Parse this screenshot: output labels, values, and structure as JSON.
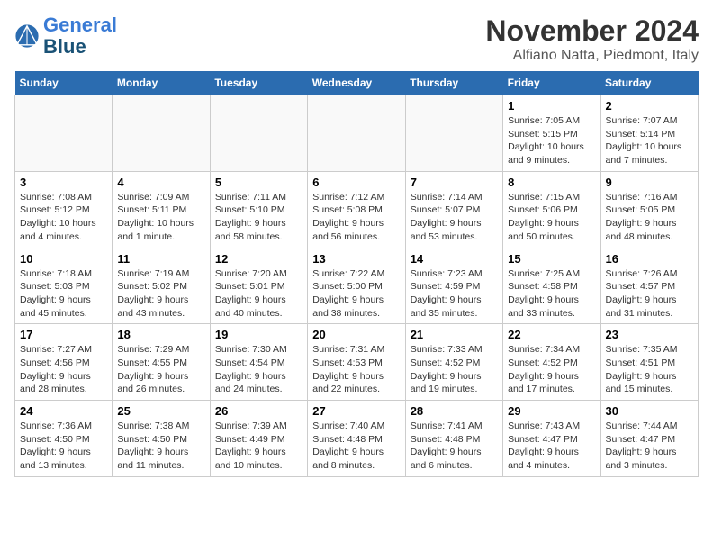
{
  "header": {
    "logo_line1": "General",
    "logo_line2": "Blue",
    "month": "November 2024",
    "location": "Alfiano Natta, Piedmont, Italy"
  },
  "weekdays": [
    "Sunday",
    "Monday",
    "Tuesday",
    "Wednesday",
    "Thursday",
    "Friday",
    "Saturday"
  ],
  "weeks": [
    [
      {
        "day": "",
        "info": "",
        "empty": true
      },
      {
        "day": "",
        "info": "",
        "empty": true
      },
      {
        "day": "",
        "info": "",
        "empty": true
      },
      {
        "day": "",
        "info": "",
        "empty": true
      },
      {
        "day": "",
        "info": "",
        "empty": true
      },
      {
        "day": "1",
        "info": "Sunrise: 7:05 AM\nSunset: 5:15 PM\nDaylight: 10 hours and 9 minutes.",
        "empty": false
      },
      {
        "day": "2",
        "info": "Sunrise: 7:07 AM\nSunset: 5:14 PM\nDaylight: 10 hours and 7 minutes.",
        "empty": false
      }
    ],
    [
      {
        "day": "3",
        "info": "Sunrise: 7:08 AM\nSunset: 5:12 PM\nDaylight: 10 hours and 4 minutes.",
        "empty": false
      },
      {
        "day": "4",
        "info": "Sunrise: 7:09 AM\nSunset: 5:11 PM\nDaylight: 10 hours and 1 minute.",
        "empty": false
      },
      {
        "day": "5",
        "info": "Sunrise: 7:11 AM\nSunset: 5:10 PM\nDaylight: 9 hours and 58 minutes.",
        "empty": false
      },
      {
        "day": "6",
        "info": "Sunrise: 7:12 AM\nSunset: 5:08 PM\nDaylight: 9 hours and 56 minutes.",
        "empty": false
      },
      {
        "day": "7",
        "info": "Sunrise: 7:14 AM\nSunset: 5:07 PM\nDaylight: 9 hours and 53 minutes.",
        "empty": false
      },
      {
        "day": "8",
        "info": "Sunrise: 7:15 AM\nSunset: 5:06 PM\nDaylight: 9 hours and 50 minutes.",
        "empty": false
      },
      {
        "day": "9",
        "info": "Sunrise: 7:16 AM\nSunset: 5:05 PM\nDaylight: 9 hours and 48 minutes.",
        "empty": false
      }
    ],
    [
      {
        "day": "10",
        "info": "Sunrise: 7:18 AM\nSunset: 5:03 PM\nDaylight: 9 hours and 45 minutes.",
        "empty": false
      },
      {
        "day": "11",
        "info": "Sunrise: 7:19 AM\nSunset: 5:02 PM\nDaylight: 9 hours and 43 minutes.",
        "empty": false
      },
      {
        "day": "12",
        "info": "Sunrise: 7:20 AM\nSunset: 5:01 PM\nDaylight: 9 hours and 40 minutes.",
        "empty": false
      },
      {
        "day": "13",
        "info": "Sunrise: 7:22 AM\nSunset: 5:00 PM\nDaylight: 9 hours and 38 minutes.",
        "empty": false
      },
      {
        "day": "14",
        "info": "Sunrise: 7:23 AM\nSunset: 4:59 PM\nDaylight: 9 hours and 35 minutes.",
        "empty": false
      },
      {
        "day": "15",
        "info": "Sunrise: 7:25 AM\nSunset: 4:58 PM\nDaylight: 9 hours and 33 minutes.",
        "empty": false
      },
      {
        "day": "16",
        "info": "Sunrise: 7:26 AM\nSunset: 4:57 PM\nDaylight: 9 hours and 31 minutes.",
        "empty": false
      }
    ],
    [
      {
        "day": "17",
        "info": "Sunrise: 7:27 AM\nSunset: 4:56 PM\nDaylight: 9 hours and 28 minutes.",
        "empty": false
      },
      {
        "day": "18",
        "info": "Sunrise: 7:29 AM\nSunset: 4:55 PM\nDaylight: 9 hours and 26 minutes.",
        "empty": false
      },
      {
        "day": "19",
        "info": "Sunrise: 7:30 AM\nSunset: 4:54 PM\nDaylight: 9 hours and 24 minutes.",
        "empty": false
      },
      {
        "day": "20",
        "info": "Sunrise: 7:31 AM\nSunset: 4:53 PM\nDaylight: 9 hours and 22 minutes.",
        "empty": false
      },
      {
        "day": "21",
        "info": "Sunrise: 7:33 AM\nSunset: 4:52 PM\nDaylight: 9 hours and 19 minutes.",
        "empty": false
      },
      {
        "day": "22",
        "info": "Sunrise: 7:34 AM\nSunset: 4:52 PM\nDaylight: 9 hours and 17 minutes.",
        "empty": false
      },
      {
        "day": "23",
        "info": "Sunrise: 7:35 AM\nSunset: 4:51 PM\nDaylight: 9 hours and 15 minutes.",
        "empty": false
      }
    ],
    [
      {
        "day": "24",
        "info": "Sunrise: 7:36 AM\nSunset: 4:50 PM\nDaylight: 9 hours and 13 minutes.",
        "empty": false
      },
      {
        "day": "25",
        "info": "Sunrise: 7:38 AM\nSunset: 4:50 PM\nDaylight: 9 hours and 11 minutes.",
        "empty": false
      },
      {
        "day": "26",
        "info": "Sunrise: 7:39 AM\nSunset: 4:49 PM\nDaylight: 9 hours and 10 minutes.",
        "empty": false
      },
      {
        "day": "27",
        "info": "Sunrise: 7:40 AM\nSunset: 4:48 PM\nDaylight: 9 hours and 8 minutes.",
        "empty": false
      },
      {
        "day": "28",
        "info": "Sunrise: 7:41 AM\nSunset: 4:48 PM\nDaylight: 9 hours and 6 minutes.",
        "empty": false
      },
      {
        "day": "29",
        "info": "Sunrise: 7:43 AM\nSunset: 4:47 PM\nDaylight: 9 hours and 4 minutes.",
        "empty": false
      },
      {
        "day": "30",
        "info": "Sunrise: 7:44 AM\nSunset: 4:47 PM\nDaylight: 9 hours and 3 minutes.",
        "empty": false
      }
    ]
  ]
}
